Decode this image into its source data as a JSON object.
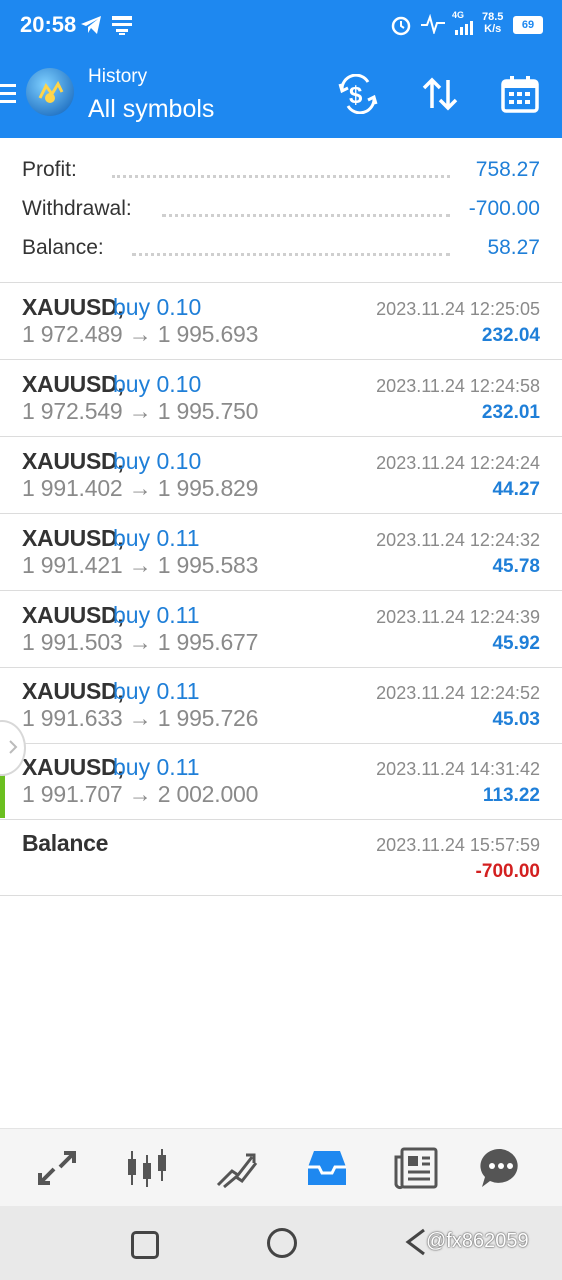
{
  "status_bar": {
    "time": "20:58",
    "net_speed_value": "78.5",
    "net_speed_unit": "K/s",
    "battery": "69",
    "network_badge": "4G"
  },
  "app_bar": {
    "title": "History",
    "subtitle": "All symbols",
    "icons": [
      "menu-icon",
      "app-logo",
      "currency-exchange-icon",
      "sort-icon",
      "calendar-icon"
    ]
  },
  "summary": {
    "profit_label": "Profit:",
    "profit_value": "758.27",
    "withdrawal_label": "Withdrawal:",
    "withdrawal_value": "-700.00",
    "balance_label": "Balance:",
    "balance_value": "58.27"
  },
  "deals": [
    {
      "symbol": "XAUUSD,",
      "side": "buy 0.10",
      "prices": "1 972.489 → 1 995.693",
      "datetime": "2023.11.24 12:25:05",
      "profit": "232.04"
    },
    {
      "symbol": "XAUUSD,",
      "side": "buy 0.10",
      "prices": "1 972.549 → 1 995.750",
      "datetime": "2023.11.24 12:24:58",
      "profit": "232.01"
    },
    {
      "symbol": "XAUUSD,",
      "side": "buy 0.10",
      "prices": "1 991.402 → 1 995.829",
      "datetime": "2023.11.24 12:24:24",
      "profit": "44.27"
    },
    {
      "symbol": "XAUUSD,",
      "side": "buy 0.11",
      "prices": "1 991.421 → 1 995.583",
      "datetime": "2023.11.24 12:24:32",
      "profit": "45.78"
    },
    {
      "symbol": "XAUUSD,",
      "side": "buy 0.11",
      "prices": "1 991.503 → 1 995.677",
      "datetime": "2023.11.24 12:24:39",
      "profit": "45.92"
    },
    {
      "symbol": "XAUUSD,",
      "side": "buy 0.11",
      "prices": "1 991.633 → 1 995.726",
      "datetime": "2023.11.24 12:24:52",
      "profit": "45.03"
    },
    {
      "symbol": "XAUUSD,",
      "side": "buy 0.11",
      "prices": "1 991.707 → 2 002.000",
      "datetime": "2023.11.24 14:31:42",
      "profit": "113.22"
    }
  ],
  "balance_entry": {
    "label": "Balance",
    "datetime": "2023.11.24 15:57:59",
    "amount": "-700.00"
  },
  "bottom_nav": {
    "items": [
      "quotes-icon",
      "chart-icon",
      "trade-icon",
      "history-icon",
      "news-icon",
      "chat-icon"
    ],
    "active": "history-icon"
  },
  "system_nav": {
    "items": [
      "recents-button",
      "home-button",
      "back-button"
    ],
    "watermark": "@fx862059"
  },
  "colors": {
    "accent": "#1e88f0",
    "positive": "#1f7fd8",
    "negative": "#d32020"
  }
}
